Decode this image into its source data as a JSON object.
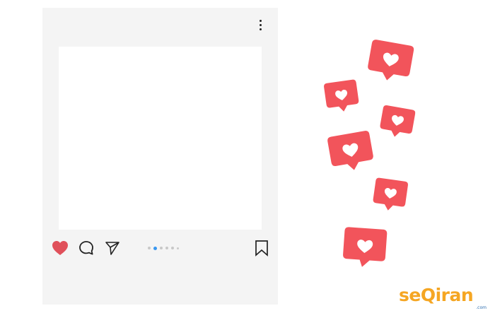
{
  "post": {
    "menu_icon": "more-vertical-icon",
    "actions": {
      "like_icon": "heart-icon",
      "comment_icon": "comment-icon",
      "share_icon": "send-icon",
      "save_icon": "bookmark-icon"
    },
    "carousel": {
      "count": 6,
      "active_index": 1
    }
  },
  "notifications": {
    "icon": "heart-icon",
    "count": 6
  },
  "colors": {
    "card_background": "#f4f4f4",
    "like_heart": "#e0505a",
    "notification_bubble": "#f2545b",
    "carousel_active": "#3897f0",
    "logo_primary": "#f5a623",
    "logo_secondary": "#2f6fb0"
  },
  "brand": {
    "logo_text": "seQiran",
    "logo_suffix": ".com"
  }
}
